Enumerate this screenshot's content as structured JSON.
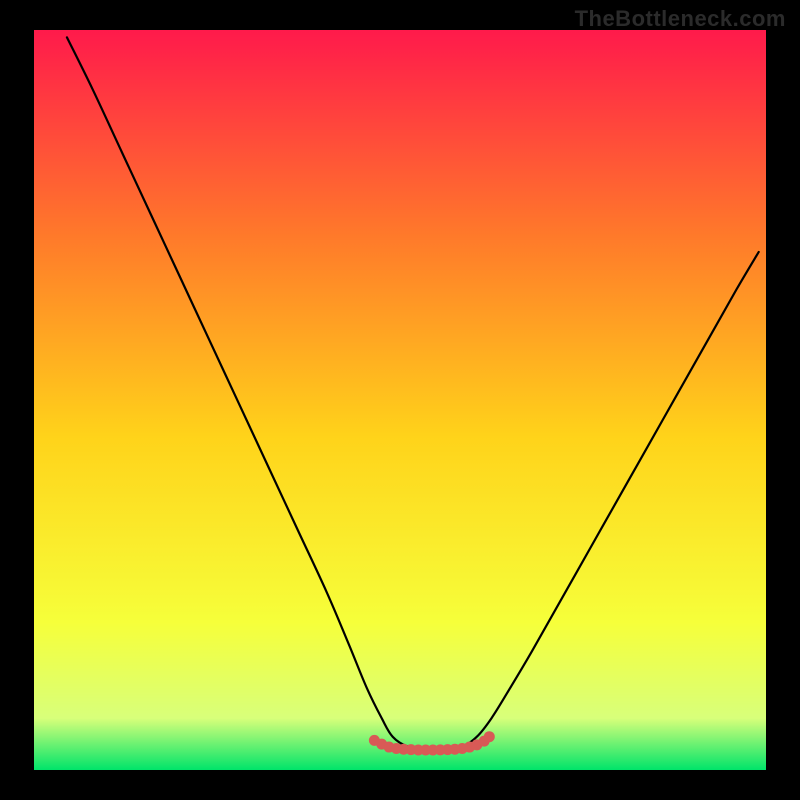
{
  "watermark": "TheBottleneck.com",
  "chart_data": {
    "type": "line",
    "title": "",
    "xlabel": "",
    "ylabel": "",
    "xlim": [
      0,
      100
    ],
    "ylim": [
      0,
      100
    ],
    "axes_visible": false,
    "grid": false,
    "background_gradient": {
      "top": "#ff1a4b",
      "mid_upper": "#ff7a2a",
      "mid": "#ffd31a",
      "mid_lower": "#f6ff3a",
      "band": "#d8ff7a",
      "bottom": "#00e46a"
    },
    "series": [
      {
        "name": "curve",
        "stroke": "#000000",
        "type": "line",
        "points": [
          {
            "x": 4.5,
            "y": 99.0
          },
          {
            "x": 8.0,
            "y": 92.0
          },
          {
            "x": 12.0,
            "y": 83.5
          },
          {
            "x": 16.0,
            "y": 75.0
          },
          {
            "x": 20.0,
            "y": 66.5
          },
          {
            "x": 24.0,
            "y": 58.0
          },
          {
            "x": 28.0,
            "y": 49.5
          },
          {
            "x": 32.0,
            "y": 41.0
          },
          {
            "x": 36.0,
            "y": 32.5
          },
          {
            "x": 40.0,
            "y": 24.0
          },
          {
            "x": 43.0,
            "y": 17.0
          },
          {
            "x": 45.5,
            "y": 11.0
          },
          {
            "x": 47.5,
            "y": 7.0
          },
          {
            "x": 49.0,
            "y": 4.5
          },
          {
            "x": 51.0,
            "y": 3.2
          },
          {
            "x": 53.5,
            "y": 2.8
          },
          {
            "x": 56.0,
            "y": 2.8
          },
          {
            "x": 58.5,
            "y": 3.2
          },
          {
            "x": 60.5,
            "y": 4.5
          },
          {
            "x": 62.5,
            "y": 7.0
          },
          {
            "x": 65.0,
            "y": 11.0
          },
          {
            "x": 68.0,
            "y": 16.0
          },
          {
            "x": 72.0,
            "y": 23.0
          },
          {
            "x": 76.0,
            "y": 30.0
          },
          {
            "x": 80.0,
            "y": 37.0
          },
          {
            "x": 84.0,
            "y": 44.0
          },
          {
            "x": 88.0,
            "y": 51.0
          },
          {
            "x": 92.0,
            "y": 58.0
          },
          {
            "x": 96.0,
            "y": 65.0
          },
          {
            "x": 99.0,
            "y": 70.0
          }
        ]
      },
      {
        "name": "trough-marker",
        "stroke": "#d85a56",
        "type": "scatter",
        "points": [
          {
            "x": 46.5,
            "y": 4.0
          },
          {
            "x": 47.5,
            "y": 3.5
          },
          {
            "x": 48.5,
            "y": 3.1
          },
          {
            "x": 49.5,
            "y": 2.9
          },
          {
            "x": 50.5,
            "y": 2.8
          },
          {
            "x": 51.5,
            "y": 2.75
          },
          {
            "x": 52.5,
            "y": 2.7
          },
          {
            "x": 53.5,
            "y": 2.7
          },
          {
            "x": 54.5,
            "y": 2.7
          },
          {
            "x": 55.5,
            "y": 2.72
          },
          {
            "x": 56.5,
            "y": 2.75
          },
          {
            "x": 57.5,
            "y": 2.8
          },
          {
            "x": 58.5,
            "y": 2.9
          },
          {
            "x": 59.5,
            "y": 3.1
          },
          {
            "x": 60.5,
            "y": 3.4
          },
          {
            "x": 61.5,
            "y": 3.9
          },
          {
            "x": 62.2,
            "y": 4.5
          }
        ]
      }
    ]
  }
}
